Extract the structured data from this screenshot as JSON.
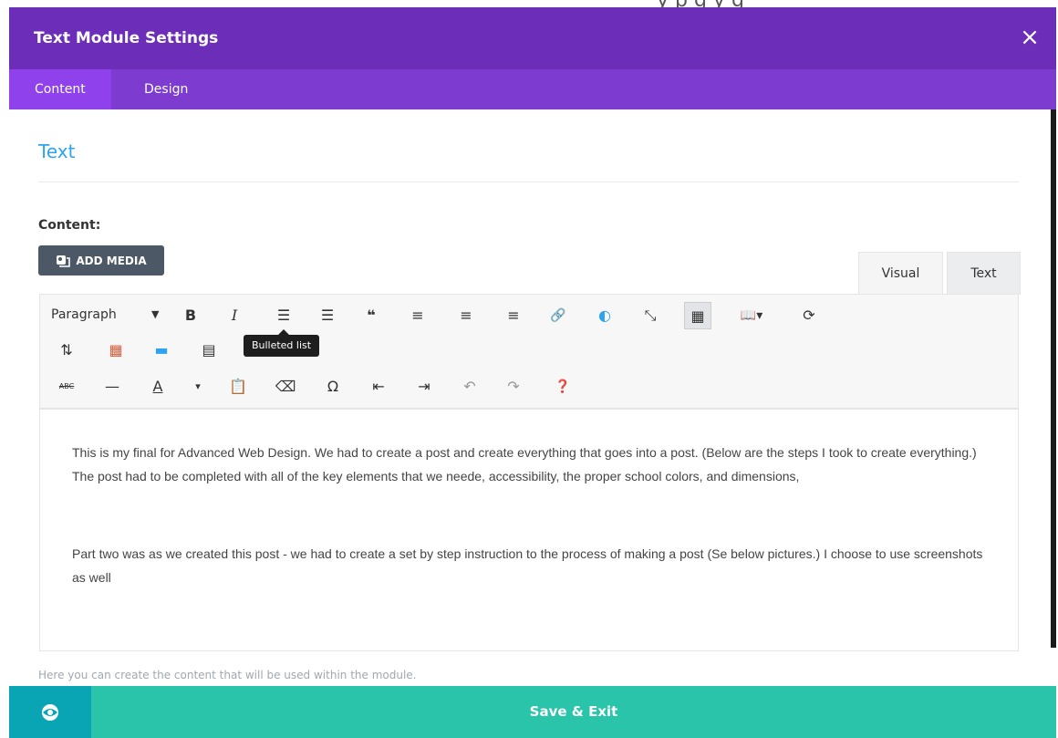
{
  "background_text": "y p g y g",
  "header": {
    "title": "Text Module Settings",
    "close_symbol": "×"
  },
  "tabs": [
    {
      "label": "Content",
      "active": true
    },
    {
      "label": "Design",
      "active": false
    }
  ],
  "section": {
    "title": "Text"
  },
  "content_label": "Content:",
  "add_media": {
    "label": "ADD MEDIA",
    "icon": "add-media-icon"
  },
  "editor_tabs": [
    {
      "label": "Visual",
      "active": true
    },
    {
      "label": "Text",
      "active": false
    }
  ],
  "toolbar": {
    "format_select": "Paragraph",
    "row1": [
      {
        "name": "bold-button",
        "glyph": "B"
      },
      {
        "name": "italic-button",
        "glyph": "I"
      },
      {
        "name": "bulleted-list-button",
        "glyph": "☰"
      },
      {
        "name": "numbered-list-button",
        "glyph": "☰"
      },
      {
        "name": "blockquote-button",
        "glyph": "❝"
      },
      {
        "name": "align-left-button",
        "glyph": "≡"
      },
      {
        "name": "align-center-button",
        "glyph": "≡"
      },
      {
        "name": "align-right-button",
        "glyph": "≡"
      },
      {
        "name": "insert-link-button",
        "glyph": "🔗"
      },
      {
        "name": "brand-button",
        "glyph": "◐"
      },
      {
        "name": "fullscreen-button",
        "glyph": "⤡"
      },
      {
        "name": "toolbar-toggle-button",
        "glyph": "▦"
      },
      {
        "name": "book-dropdown-button",
        "glyph": "📖▾"
      },
      {
        "name": "refresh-button",
        "glyph": "⟳"
      }
    ],
    "row2": [
      {
        "name": "sort-button",
        "glyph": "⇅"
      },
      {
        "name": "color-grid-button",
        "glyph": "▦"
      },
      {
        "name": "stack-button",
        "glyph": "▬"
      },
      {
        "name": "document-button",
        "glyph": "▤"
      }
    ],
    "row3": [
      {
        "name": "strikethrough-button",
        "glyph": "ABC"
      },
      {
        "name": "horizontal-line-button",
        "glyph": "—"
      },
      {
        "name": "text-color-button",
        "glyph": "A"
      },
      {
        "name": "text-color-dropdown",
        "glyph": "▾"
      },
      {
        "name": "paste-text-button",
        "glyph": "📋"
      },
      {
        "name": "clear-formatting-button",
        "glyph": "⌫"
      },
      {
        "name": "special-character-button",
        "glyph": "Ω"
      },
      {
        "name": "outdent-button",
        "glyph": "⇤"
      },
      {
        "name": "indent-button",
        "glyph": "⇥"
      },
      {
        "name": "undo-button",
        "glyph": "↶"
      },
      {
        "name": "redo-button",
        "glyph": "↷"
      },
      {
        "name": "help-button",
        "glyph": "❓"
      }
    ],
    "tooltip": "Bulleted list"
  },
  "editor": {
    "paragraphs": [
      "This is my final for Advanced Web Design. We had to create a post and create everything that goes into a post. (Below are the steps I took to create everything.) The post had to be completed with all of the key elements that we neede, accessibility, the proper school colors, and dimensions,",
      "Part two was as we created this post - we had to create a set by step instruction to the process of making a post (Se below pictures.) I choose to use screenshots as well"
    ]
  },
  "helper_text": "Here you can create the content that will be used within the module.",
  "footer": {
    "save_label": "Save & Exit",
    "preview_icon": "eye-icon"
  },
  "colors": {
    "header": "#6c2eb9",
    "tabbar": "#7e3bd0",
    "accent": "#2ea3f2",
    "save": "#29c4a9",
    "preview": "#0aa5b5"
  }
}
